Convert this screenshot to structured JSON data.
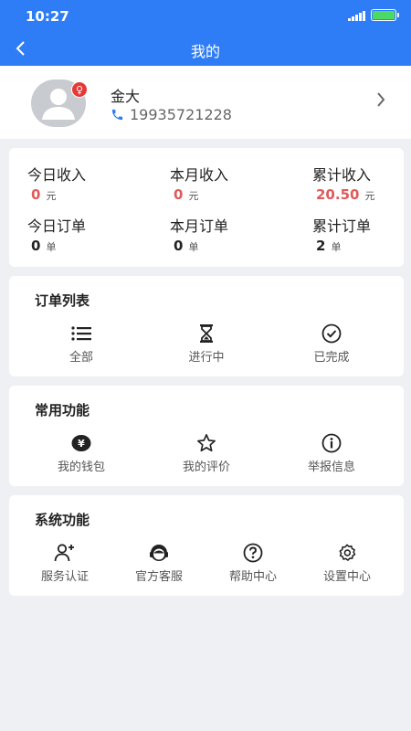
{
  "status": {
    "time": "10:27"
  },
  "header": {
    "title": "我的"
  },
  "profile": {
    "name": "金大",
    "phone": "19935721228",
    "gender_symbol": "♀"
  },
  "stats": [
    {
      "label": "今日收入",
      "value": "0",
      "unit": "元"
    },
    {
      "label": "本月收入",
      "value": "0",
      "unit": "元"
    },
    {
      "label": "累计收入",
      "value": "20.50",
      "unit": "元"
    },
    {
      "label": "今日订单",
      "value": "0",
      "unit": "单"
    },
    {
      "label": "本月订单",
      "value": "0",
      "unit": "单"
    },
    {
      "label": "累计订单",
      "value": "2",
      "unit": "单"
    }
  ],
  "orders": {
    "title": "订单列表",
    "items": [
      {
        "label": "全部",
        "icon": "list-icon"
      },
      {
        "label": "进行中",
        "icon": "hourglass-icon"
      },
      {
        "label": "已完成",
        "icon": "check-circle-icon"
      }
    ]
  },
  "common": {
    "title": "常用功能",
    "items": [
      {
        "label": "我的钱包",
        "icon": "wallet-icon"
      },
      {
        "label": "我的评价",
        "icon": "star-icon"
      },
      {
        "label": "举报信息",
        "icon": "info-icon"
      }
    ]
  },
  "system": {
    "title": "系统功能",
    "items": [
      {
        "label": "服务认证",
        "icon": "user-add-icon"
      },
      {
        "label": "官方客服",
        "icon": "customer-service-icon"
      },
      {
        "label": "帮助中心",
        "icon": "help-icon"
      },
      {
        "label": "设置中心",
        "icon": "settings-icon"
      }
    ]
  },
  "colors": {
    "primary": "#2f7df6",
    "income_red": "#e05a5a",
    "background": "#eef0f3"
  }
}
